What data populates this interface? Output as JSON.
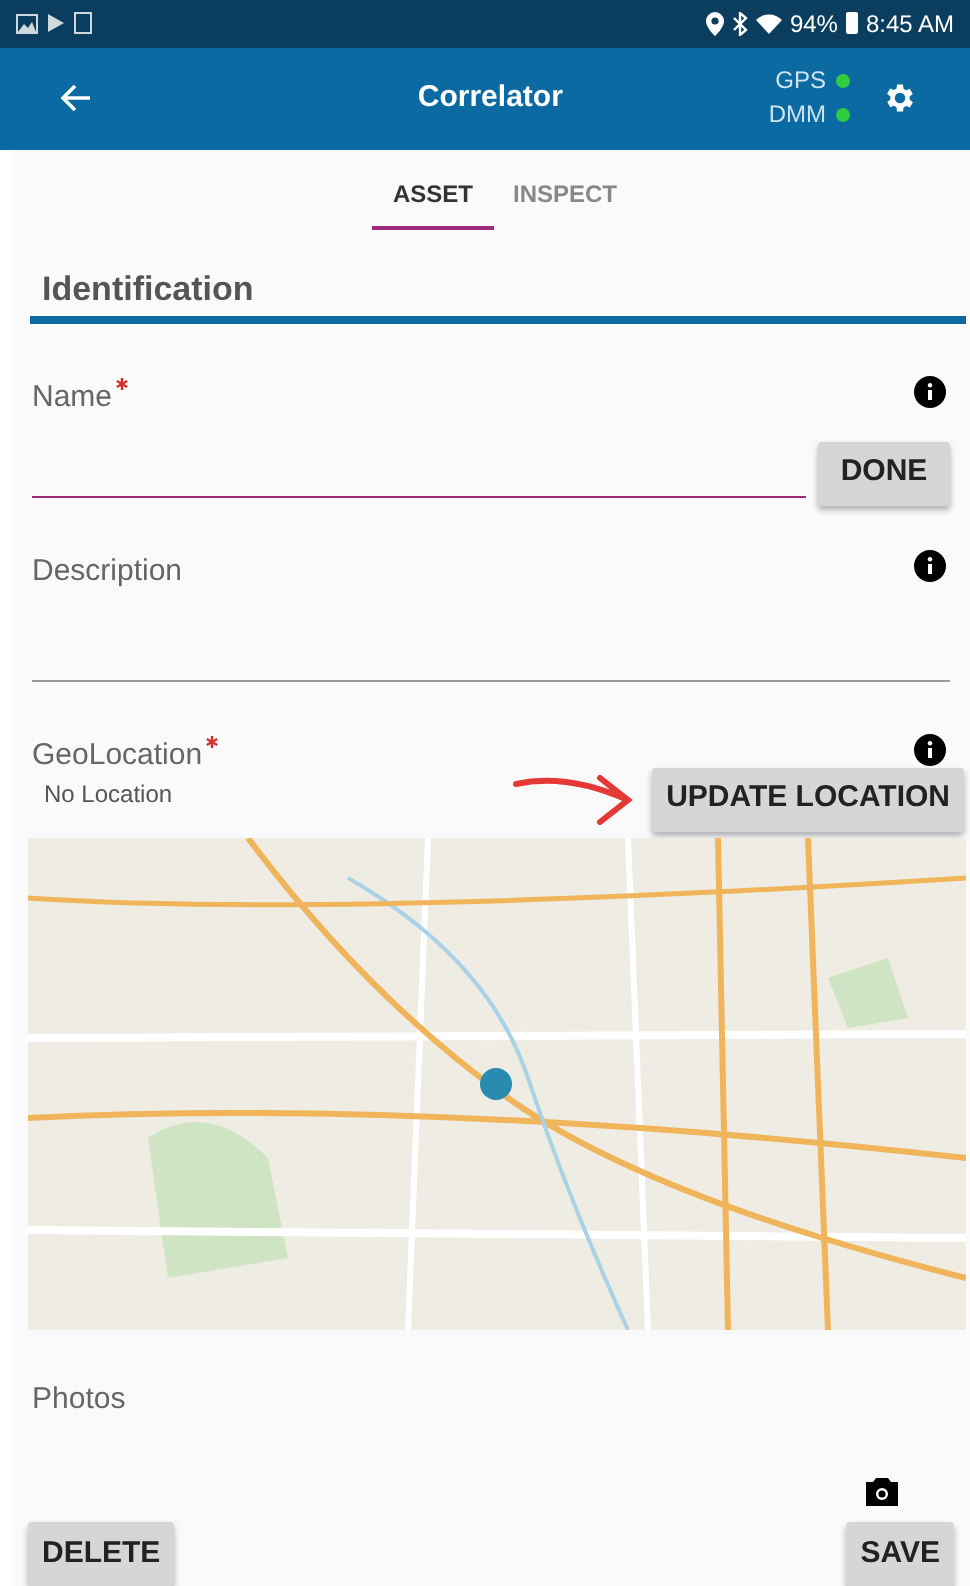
{
  "status_bar": {
    "battery": "94%",
    "time": "8:45 AM"
  },
  "app_bar": {
    "title": "Correlator",
    "indicators": [
      {
        "label": "GPS",
        "on": true
      },
      {
        "label": "DMM",
        "on": true
      }
    ]
  },
  "tabs": [
    {
      "label": "ASSET",
      "selected": true
    },
    {
      "label": "INSPECT",
      "selected": false
    }
  ],
  "section_title": "Identification",
  "fields": [
    {
      "kind": "text",
      "label": "Name",
      "required": true,
      "focused": true,
      "button": "DONE"
    },
    {
      "kind": "text",
      "label": "Description",
      "required": false,
      "focused": false
    },
    {
      "kind": "location",
      "label": "GeoLocation",
      "required": true,
      "value": "No Location",
      "button": "UPDATE LOCATION"
    },
    {
      "kind": "photos",
      "label": "Photos"
    }
  ],
  "buttons": [
    "DELETE",
    "SAVE"
  ]
}
